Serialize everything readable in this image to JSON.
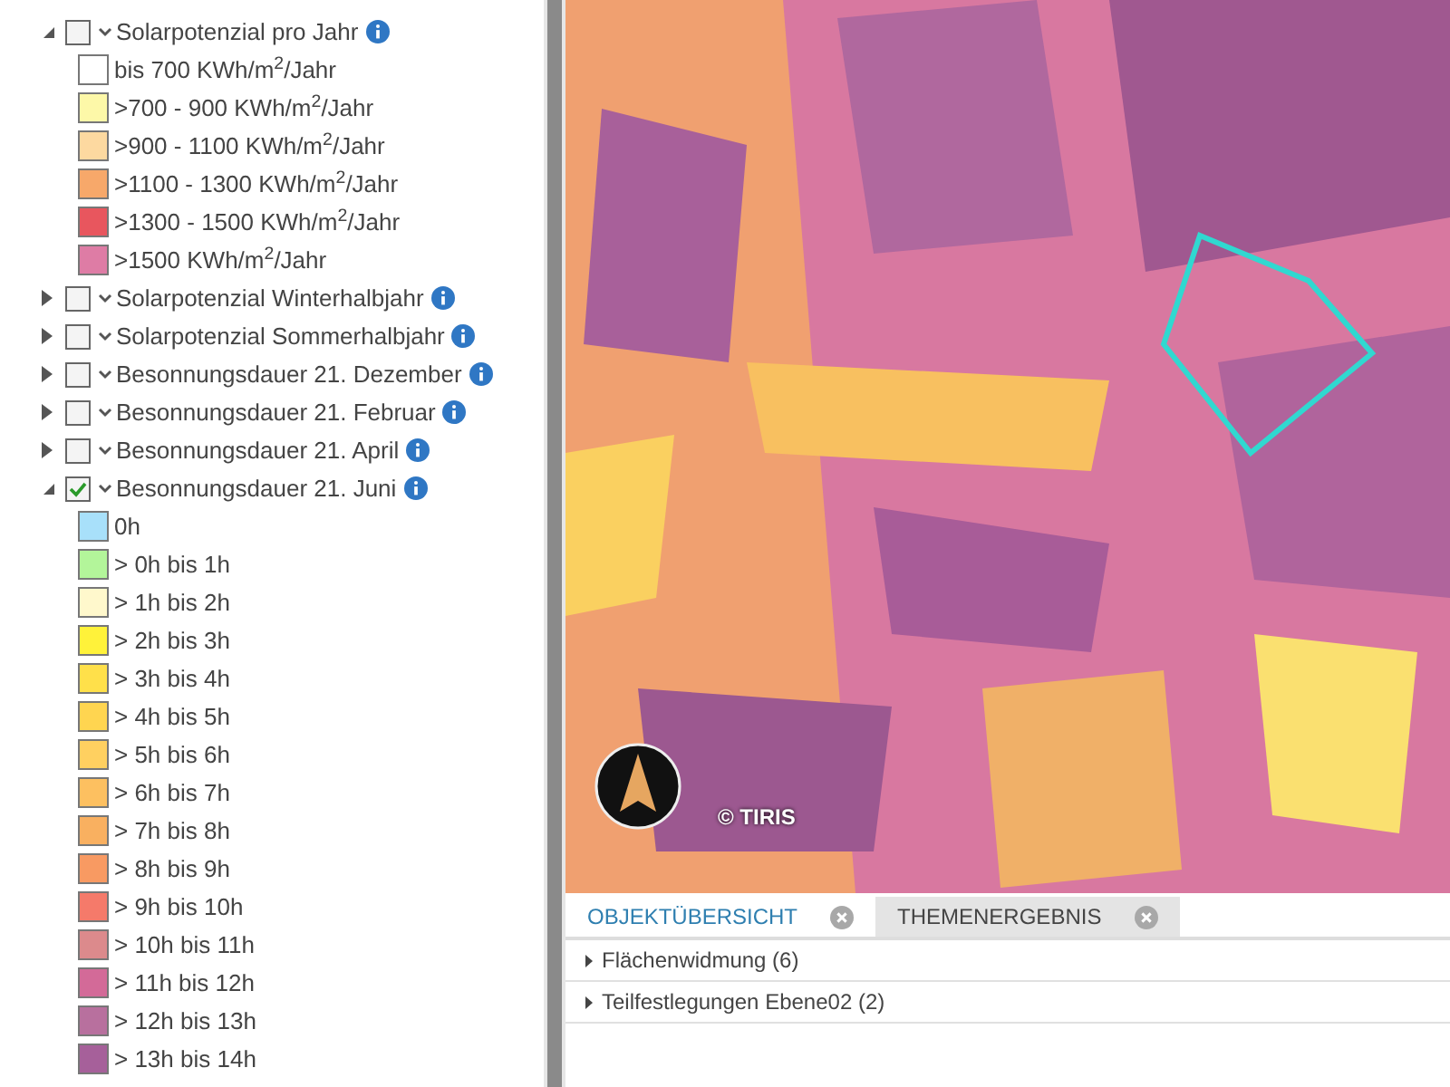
{
  "layers": [
    {
      "label": "Solarpotenzial pro Jahr",
      "expanded": true,
      "checked": false,
      "info": true,
      "children": [
        {
          "label": "bis 700 KWh/m$^{2}$/Jahr",
          "color": "#ffffff"
        },
        {
          "label": ">700 - 900 KWh/m$^{2}$/Jahr",
          "color": "#fdf8a8"
        },
        {
          "label": ">900 - 1100 KWh/m$^{2}$/Jahr",
          "color": "#fdd9a0"
        },
        {
          "label": ">1100 - 1300 KWh/m$^{2}$/Jahr",
          "color": "#f7a86a"
        },
        {
          "label": ">1300 - 1500 KWh/m$^{2}$/Jahr",
          "color": "#e8565e"
        },
        {
          "label": ">1500 KWh/m$^{2}$/Jahr",
          "color": "#de7ca5"
        }
      ]
    },
    {
      "label": "Solarpotenzial Winterhalbjahr",
      "expanded": false,
      "checked": false,
      "info": true
    },
    {
      "label": "Solarpotenzial Sommerhalbjahr",
      "expanded": false,
      "checked": false,
      "info": true
    },
    {
      "label": "Besonnungsdauer 21. Dezember",
      "expanded": false,
      "checked": false,
      "info": true
    },
    {
      "label": "Besonnungsdauer 21. Februar",
      "expanded": false,
      "checked": false,
      "info": true
    },
    {
      "label": "Besonnungsdauer 21. April",
      "expanded": false,
      "checked": false,
      "info": true
    },
    {
      "label": "Besonnungsdauer 21. Juni",
      "expanded": true,
      "checked": true,
      "info": true,
      "children": [
        {
          "label": "0h",
          "color": "#a8e0fa"
        },
        {
          "label": "> 0h bis 1h",
          "color": "#b3f59a"
        },
        {
          "label": "> 1h bis 2h",
          "color": "#fff8cc"
        },
        {
          "label": "> 2h bis 3h",
          "color": "#fff23a"
        },
        {
          "label": "> 3h bis 4h",
          "color": "#ffe04a"
        },
        {
          "label": "> 4h bis 5h",
          "color": "#ffd550"
        },
        {
          "label": "> 5h bis 6h",
          "color": "#ffd060"
        },
        {
          "label": "> 6h bis 7h",
          "color": "#fdc060"
        },
        {
          "label": "> 7h bis 8h",
          "color": "#f9b060"
        },
        {
          "label": "> 8h bis 9h",
          "color": "#f89a62"
        },
        {
          "label": "> 9h bis 10h",
          "color": "#f57a6a"
        },
        {
          "label": "> 10h bis 11h",
          "color": "#dc8a8c"
        },
        {
          "label": "> 11h bis 12h",
          "color": "#d36a98"
        },
        {
          "label": "> 12h bis 13h",
          "color": "#b8709e"
        },
        {
          "label": "> 13h bis 14h",
          "color": "#a6609a"
        }
      ]
    }
  ],
  "map": {
    "attribution": "© TIRIS"
  },
  "result_tabs": [
    {
      "label": "OBJEKTÜBERSICHT",
      "selected": true
    },
    {
      "label": "THEMENERGEBNIS",
      "selected": false
    }
  ],
  "result_rows": [
    {
      "label": "Flächenwidmung (6)",
      "expanded": false
    },
    {
      "label": "Teilfestlegungen Ebene02 (2)",
      "expanded": false
    }
  ]
}
